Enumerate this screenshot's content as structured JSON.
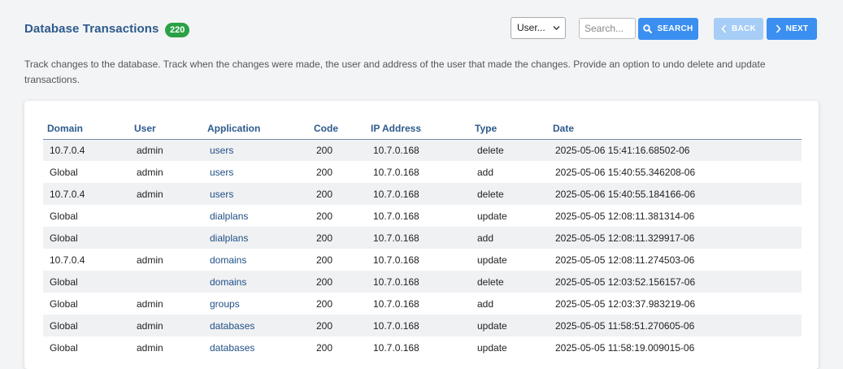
{
  "header": {
    "title": "Database Transactions",
    "count": "220",
    "user_select": {
      "selected": "User..."
    },
    "search": {
      "placeholder": "Search..."
    },
    "search_label": "Search",
    "back_label": "Back",
    "next_label": "Next"
  },
  "description": "Track changes to the database. Track when the changes were made, the user and address of the user that made the changes. Provide an option to undo delete and update transactions.",
  "colors": {
    "title": "#2d5a8c",
    "badge": "#2aa146",
    "primary_button": "#3b8ff0",
    "disabled_button": "#a6cdf5",
    "link": "#1f4f86"
  },
  "icons": {
    "search": "search-icon",
    "back": "chevron-left-icon",
    "next": "chevron-right-icon",
    "select": "chevron-down-icon"
  },
  "table": {
    "columns": [
      "Domain",
      "User",
      "Application",
      "Code",
      "IP Address",
      "Type",
      "Date"
    ],
    "rows": [
      [
        "10.7.0.4",
        "admin",
        "users",
        "200",
        "10.7.0.168",
        "delete",
        "2025-05-06 15:41:16.68502-06"
      ],
      [
        "Global",
        "admin",
        "users",
        "200",
        "10.7.0.168",
        "add",
        "2025-05-06 15:40:55.346208-06"
      ],
      [
        "10.7.0.4",
        "admin",
        "users",
        "200",
        "10.7.0.168",
        "delete",
        "2025-05-06 15:40:55.184166-06"
      ],
      [
        "Global",
        "",
        "dialplans",
        "200",
        "10.7.0.168",
        "update",
        "2025-05-05 12:08:11.381314-06"
      ],
      [
        "Global",
        "",
        "dialplans",
        "200",
        "10.7.0.168",
        "add",
        "2025-05-05 12:08:11.329917-06"
      ],
      [
        "10.7.0.4",
        "admin",
        "domains",
        "200",
        "10.7.0.168",
        "update",
        "2025-05-05 12:08:11.274503-06"
      ],
      [
        "Global",
        "",
        "domains",
        "200",
        "10.7.0.168",
        "delete",
        "2025-05-05 12:03:52.156157-06"
      ],
      [
        "Global",
        "admin",
        "groups",
        "200",
        "10.7.0.168",
        "add",
        "2025-05-05 12:03:37.983219-06"
      ],
      [
        "Global",
        "admin",
        "databases",
        "200",
        "10.7.0.168",
        "update",
        "2025-05-05 11:58:51.270605-06"
      ],
      [
        "Global",
        "admin",
        "databases",
        "200",
        "10.7.0.168",
        "update",
        "2025-05-05 11:58:19.009015-06"
      ]
    ]
  }
}
